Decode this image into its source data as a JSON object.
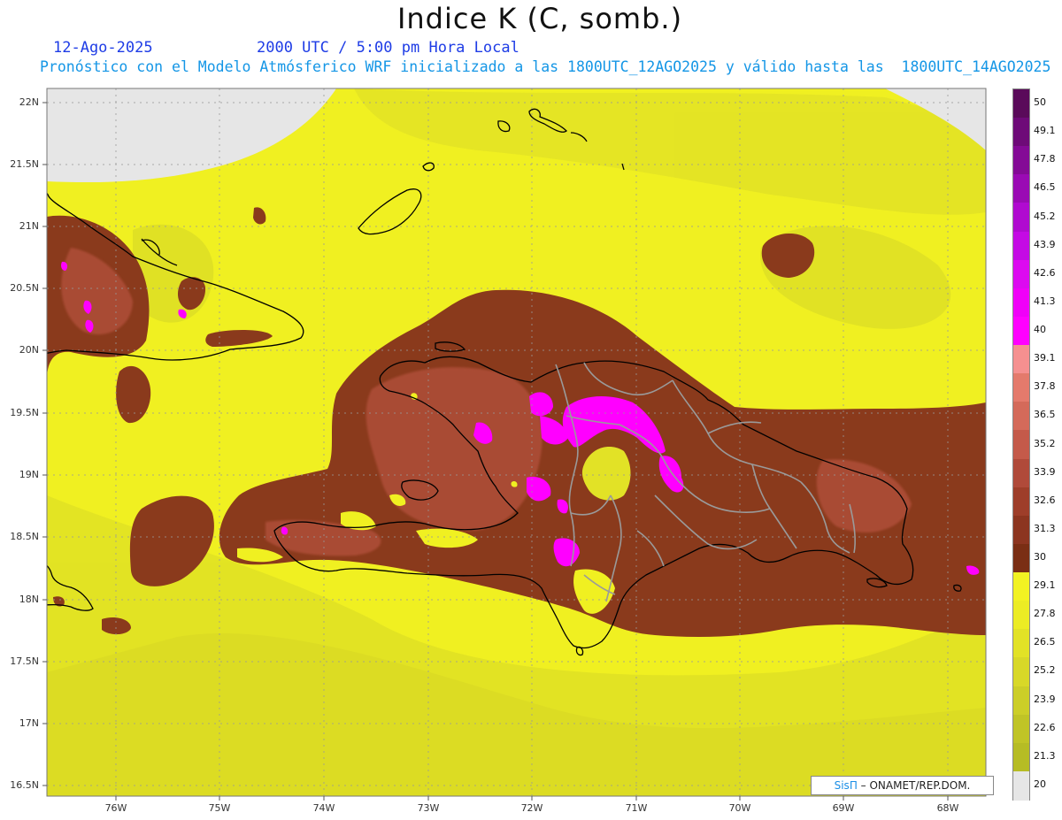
{
  "header": {
    "title": "Indice K (C, somb.)",
    "date": "12-Ago-2025",
    "time": "2000 UTC / 5:00 pm Hora Local",
    "forecast": "Pronóstico con el Modelo Atmósferico WRF inicializado a las 1800UTC_12AGO2025 y válido hasta las  1800UTC_14AGO2025"
  },
  "axes": {
    "lat_labels": [
      "22N",
      "21.5N",
      "21N",
      "20.5N",
      "20N",
      "19.5N",
      "19N",
      "18.5N",
      "18N",
      "17.5N",
      "17N",
      "16.5N"
    ],
    "lon_labels": [
      "76W",
      "75W",
      "74W",
      "73W",
      "72W",
      "71W",
      "70W",
      "69W",
      "68W"
    ]
  },
  "legend": {
    "labels": [
      "50",
      "49.1",
      "47.8",
      "46.5",
      "45.2",
      "43.9",
      "42.6",
      "41.3",
      "40",
      "39.1",
      "37.8",
      "36.5",
      "35.2",
      "33.9",
      "32.6",
      "31.3",
      "30",
      "29.1",
      "27.8",
      "26.5",
      "25.2",
      "23.9",
      "22.6",
      "21.3",
      "20"
    ],
    "colors": [
      "#5a0a5a",
      "#6e0a78",
      "#840a96",
      "#9a0ab4",
      "#b00ad0",
      "#c40ae4",
      "#dc0af0",
      "#f000f8",
      "#ff00ff",
      "#f59090",
      "#e47a6c",
      "#d46a5a",
      "#c45a4a",
      "#b04a3a",
      "#9e3e2a",
      "#8c3520",
      "#7a2e14",
      "#f2f222",
      "#ecec24",
      "#e2e226",
      "#d8d828",
      "#ccce28",
      "#c0c426",
      "#b6bc24",
      "#e6e6e6"
    ]
  },
  "colors": {
    "land_border": "#000000",
    "province_border": "#9a9a9a",
    "no_data": "#e6e6e6",
    "field_yellow": "#f0f021",
    "field_brown": "#8a3a1c",
    "field_magenta": "#ff00ff"
  },
  "credit": {
    "brand": "SisΠ",
    "text": " – ONAMET/REP.DOM."
  }
}
